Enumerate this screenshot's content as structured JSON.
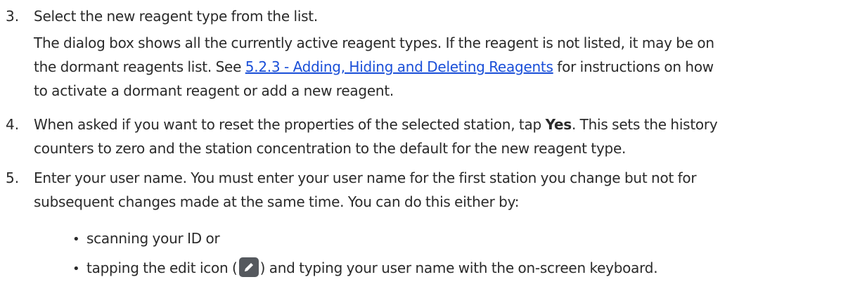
{
  "steps": [
    {
      "number": "3.",
      "heading": "Select the new reagent type from the list.",
      "para_line1": "The dialog box shows all the currently active reagent types. If the reagent is not listed, it may be on",
      "para_line2_before": "the dormant reagents list. See ",
      "para_line2_link": "5.2.3 - Adding, Hiding and Deleting Reagents",
      "para_line2_after": " for instructions on how",
      "para_line3": "to activate a dormant reagent or add a new reagent."
    },
    {
      "number": "4.",
      "line1_before": "When asked if you want to reset the properties of the selected station, tap ",
      "line1_bold": "Yes",
      "line1_after": ". This sets the history",
      "line2": "counters to zero and the station concentration to the default for the new reagent type."
    },
    {
      "number": "5.",
      "line1": "Enter your user name. You must enter your user name for the first station you change but not for",
      "line2": "subsequent changes made at the same time. You can do this either by:"
    }
  ],
  "bullets": {
    "item1": "scanning your ID or",
    "item2_before": "tapping the edit icon (",
    "item2_after": ") and typing your user name with the on-screen keyboard.",
    "edit_icon": "pencil-edit-icon",
    "bullet_glyph": "•"
  },
  "colors": {
    "text": "#2a2a2a",
    "link": "#1a4fd8",
    "icon_bg": "#55595e"
  }
}
